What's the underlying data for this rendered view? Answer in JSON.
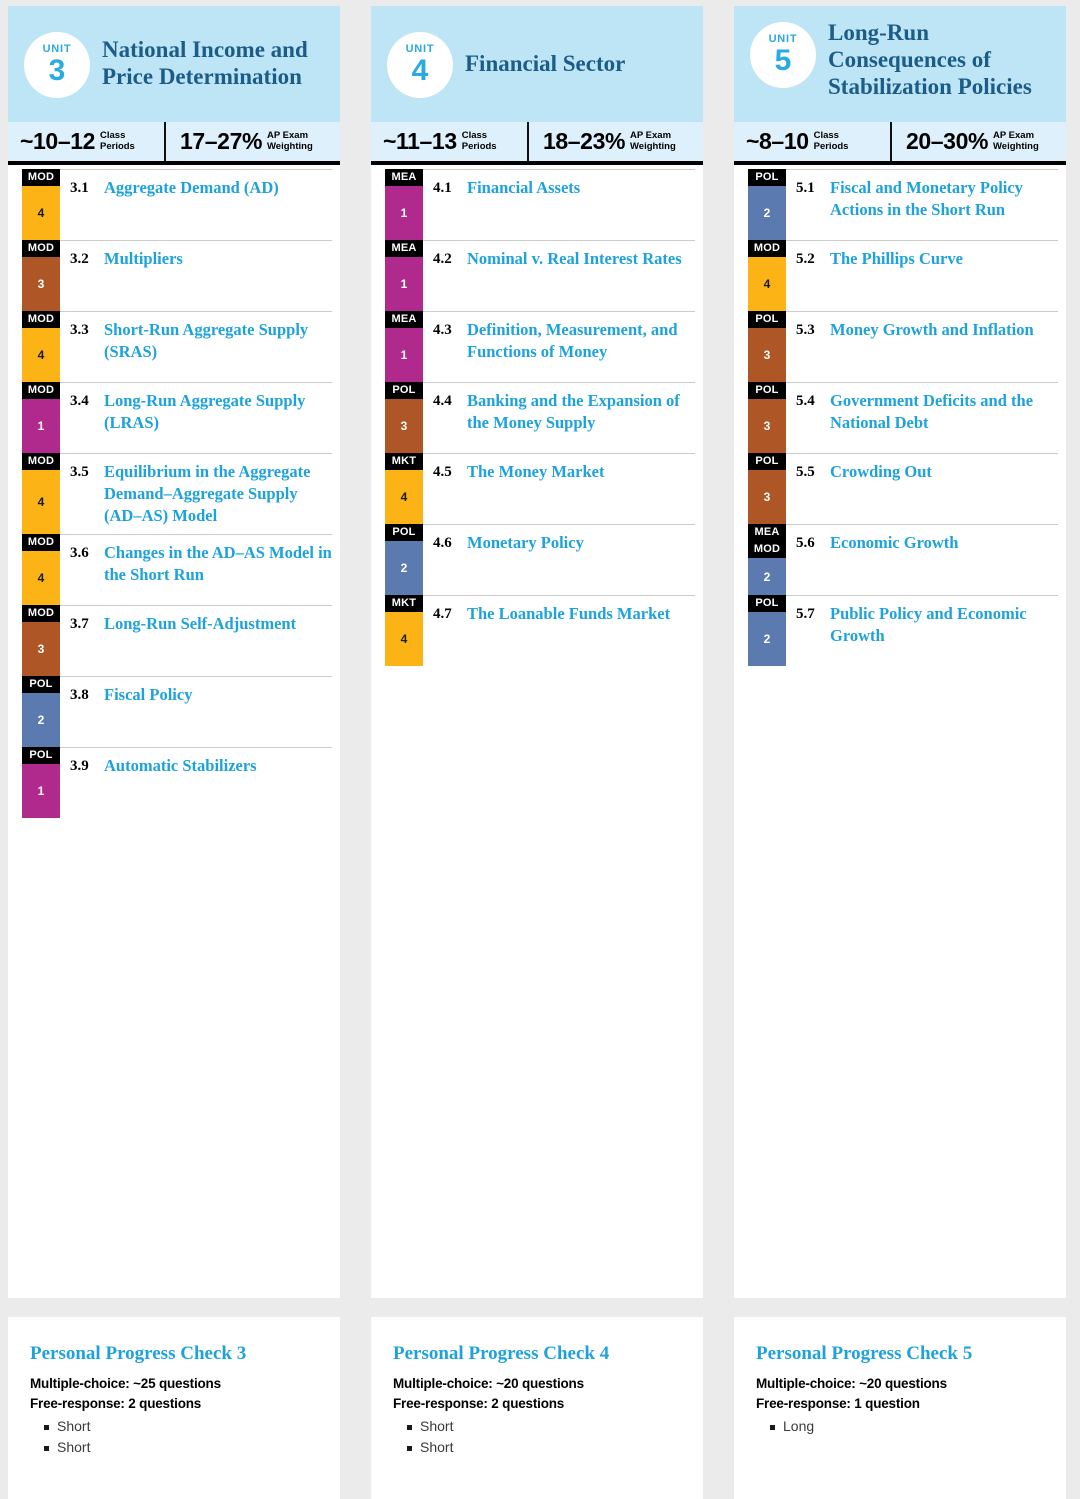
{
  "meta": {
    "accent_cyan": "#1ea2dc",
    "header_blue_bg": "#bde5f6",
    "stats_blue_bg": "#ddf0fb",
    "title_navy": "#1c5c88",
    "skill_colors": {
      "1": "#b02a8e",
      "2": "#5b7bb0",
      "3": "#ae5626",
      "4": "#fbb316"
    }
  },
  "labels": {
    "unit_word": "UNIT",
    "class_periods": "Class\nPeriods",
    "ap_exam_weighting": "AP Exam\nWeighting"
  },
  "units": [
    {
      "number": "3",
      "title": "National Income and Price Determination",
      "class_periods": "~10–12",
      "exam_weighting": "17–27%",
      "title_align": "center",
      "topics": [
        {
          "num": "3.1",
          "name": "Aggregate Demand (AD)",
          "tags": [
            "MOD"
          ],
          "skill": "4"
        },
        {
          "num": "3.2",
          "name": "Multipliers",
          "tags": [
            "MOD"
          ],
          "skill": "3"
        },
        {
          "num": "3.3",
          "name": "Short-Run Aggregate Supply (SRAS)",
          "tags": [
            "MOD"
          ],
          "skill": "4"
        },
        {
          "num": "3.4",
          "name": "Long-Run Aggregate Supply (LRAS)",
          "tags": [
            "MOD"
          ],
          "skill": "1"
        },
        {
          "num": "3.5",
          "name": "Equilibrium in the Aggregate Demand–Aggregate Supply (AD–AS) Model",
          "tags": [
            "MOD"
          ],
          "skill": "4"
        },
        {
          "num": "3.6",
          "name": "Changes in the AD–AS Model in the Short Run",
          "tags": [
            "MOD"
          ],
          "skill": "4"
        },
        {
          "num": "3.7",
          "name": "Long-Run Self-Adjustment",
          "tags": [
            "MOD"
          ],
          "skill": "3"
        },
        {
          "num": "3.8",
          "name": "Fiscal Policy",
          "tags": [
            "POL"
          ],
          "skill": "2"
        },
        {
          "num": "3.9",
          "name": "Automatic Stabilizers",
          "tags": [
            "POL"
          ],
          "skill": "1"
        }
      ],
      "progress_check": {
        "title": "Personal Progress Check 3",
        "multiple_choice": "Multiple-choice: ~25 questions",
        "free_response": "Free-response: 2 questions",
        "bullets": [
          "Short",
          "Short"
        ]
      }
    },
    {
      "number": "4",
      "title": "Financial Sector",
      "class_periods": "~11–13",
      "exam_weighting": "18–23%",
      "title_align": "center",
      "topics": [
        {
          "num": "4.1",
          "name": "Financial Assets",
          "tags": [
            "MEA"
          ],
          "skill": "1"
        },
        {
          "num": "4.2",
          "name": "Nominal v. Real Interest Rates",
          "tags": [
            "MEA"
          ],
          "skill": "1"
        },
        {
          "num": "4.3",
          "name": "Definition, Measurement, and Functions of Money",
          "tags": [
            "MEA"
          ],
          "skill": "1"
        },
        {
          "num": "4.4",
          "name": "Banking and the Expansion of the Money Supply",
          "tags": [
            "POL"
          ],
          "skill": "3"
        },
        {
          "num": "4.5",
          "name": "The Money Market",
          "tags": [
            "MKT"
          ],
          "skill": "4"
        },
        {
          "num": "4.6",
          "name": "Monetary Policy",
          "tags": [
            "POL"
          ],
          "skill": "2"
        },
        {
          "num": "4.7",
          "name": "The Loanable Funds Market",
          "tags": [
            "MKT"
          ],
          "skill": "4"
        }
      ],
      "progress_check": {
        "title": "Personal Progress Check 4",
        "multiple_choice": "Multiple-choice: ~20 questions",
        "free_response": "Free-response: 2 questions",
        "bullets": [
          "Short",
          "Short"
        ]
      }
    },
    {
      "number": "5",
      "title": "Long-Run Consequences of Stabilization Policies",
      "class_periods": "~8–10",
      "exam_weighting": "20–30%",
      "title_align": "top",
      "topics": [
        {
          "num": "5.1",
          "name": "Fiscal and Monetary Policy Actions in the Short Run",
          "tags": [
            "POL"
          ],
          "skill": "2"
        },
        {
          "num": "5.2",
          "name": "The Phillips Curve",
          "tags": [
            "MOD"
          ],
          "skill": "4"
        },
        {
          "num": "5.3",
          "name": "Money Growth and Inflation",
          "tags": [
            "POL"
          ],
          "skill": "3"
        },
        {
          "num": "5.4",
          "name": "Government Deficits and the National Debt",
          "tags": [
            "POL"
          ],
          "skill": "3"
        },
        {
          "num": "5.5",
          "name": "Crowding Out",
          "tags": [
            "POL"
          ],
          "skill": "3"
        },
        {
          "num": "5.6",
          "name": "Economic Growth",
          "tags": [
            "MEA",
            "MOD"
          ],
          "skill": "2"
        },
        {
          "num": "5.7",
          "name": "Public Policy and Economic Growth",
          "tags": [
            "POL"
          ],
          "skill": "2"
        }
      ],
      "progress_check": {
        "title": "Personal Progress Check 5",
        "multiple_choice": "Multiple-choice: ~20 questions",
        "free_response": "Free-response: 1 question",
        "bullets": [
          "Long"
        ]
      }
    }
  ]
}
